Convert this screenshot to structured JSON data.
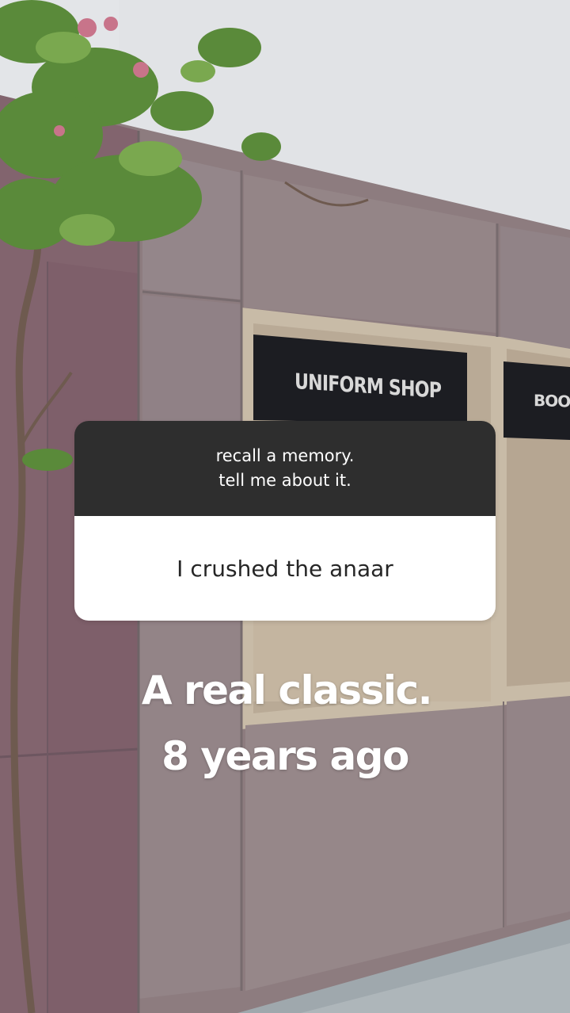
{
  "background": {
    "sign_main": "UNIFORM SHOP",
    "sign_side": "BOOK"
  },
  "question_sticker": {
    "prompt_line1": "recall a memory.",
    "prompt_line2": "tell me about it.",
    "answer": "I crushed the anaar"
  },
  "caption": {
    "line1": "A real classic.",
    "line2": "8 years ago"
  },
  "colors": {
    "sticker_header": "#2e2e2e",
    "sticker_body": "#ffffff",
    "wall": "#8e7e80",
    "sky": "#e2e4e7"
  }
}
